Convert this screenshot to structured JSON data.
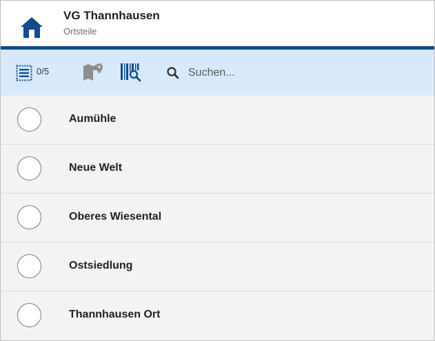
{
  "header": {
    "title": "VG Thannhausen",
    "subtitle": "Ortsteile",
    "home_icon": "home-icon"
  },
  "toolbar": {
    "selection_count": "0/5",
    "list_icon": "checklist-icon",
    "map_icon": "map-marker-icon",
    "scan_icon": "barcode-search-icon",
    "search_icon": "search-icon",
    "search_placeholder": "Suchen..."
  },
  "list": {
    "items": [
      {
        "label": "Aumühle",
        "selected": false
      },
      {
        "label": "Neue Welt",
        "selected": false
      },
      {
        "label": "Oberes Wiesental",
        "selected": false
      },
      {
        "label": "Ostsiedlung",
        "selected": false
      },
      {
        "label": "Thannhausen Ort",
        "selected": false
      }
    ]
  },
  "colors": {
    "brand": "#0f4c8a",
    "toolbar_bg": "#d8e9fb",
    "list_bg": "#f3f3f3",
    "map_icon_disabled": "#8e8e8e"
  }
}
